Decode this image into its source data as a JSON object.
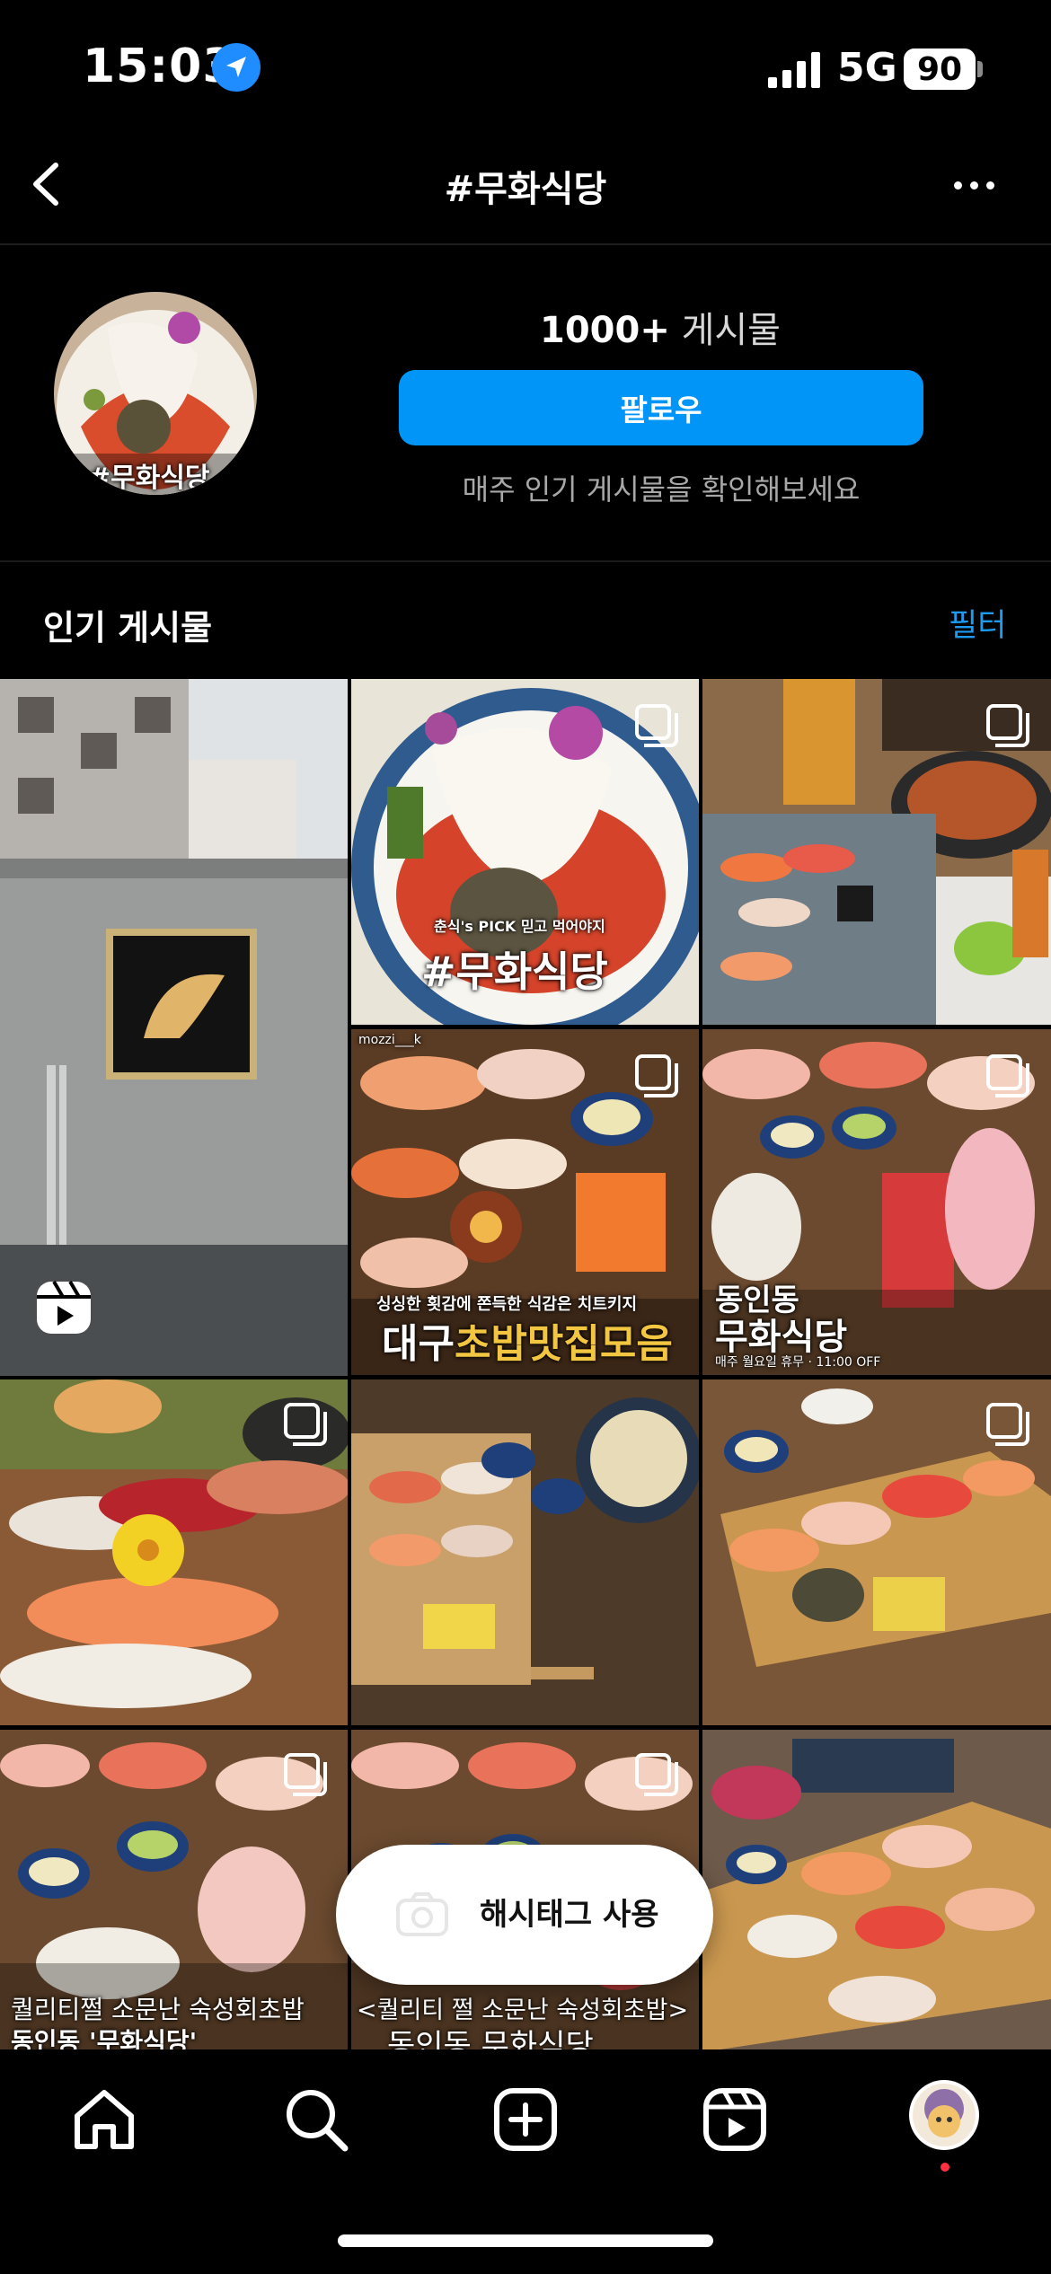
{
  "status_bar": {
    "time": "15:03",
    "network": "5G",
    "battery": "90"
  },
  "header": {
    "title": "#무화식당"
  },
  "profile": {
    "post_count": "1000+",
    "post_count_label": "게시물",
    "follow_label": "팔로우",
    "note": "매주 인기 게시물을 확인해보세요",
    "avatar_caption": "#무화식당"
  },
  "section": {
    "title": "인기 게시물",
    "filter": "필터"
  },
  "grid": {
    "captions": {
      "p2": "#무화식당",
      "p2_small": "춘식's PICK 믿고 먹어야지",
      "p4_user": "mozzi___k",
      "p4_top": "싱싱한 횟감에 쫀득한 식감은 치트키지",
      "p4_main_a": "대구",
      "p4_main_b": "초밥맛집모음",
      "p5_a": "동인동",
      "p5_b": "무화식당",
      "p5_small": "매주 월요일 휴무 · 11:00 OFF",
      "p9_a": "퀄리티쩔 소문난 숙성회초밥",
      "p9_b": "동인동 '무화식당'",
      "p10_a": "<퀄리티 쩔 소문난 숙성회초밥>",
      "p10_b": "동인동 무화식당"
    }
  },
  "toast": {
    "label": "해시태그 사용"
  },
  "tabbar": {
    "icons": [
      "home-icon",
      "search-icon",
      "create-icon",
      "reels-icon",
      "profile-avatar"
    ]
  },
  "colors": {
    "accent": "#0095f6",
    "background": "#000000",
    "link": "#1d9bf0"
  }
}
